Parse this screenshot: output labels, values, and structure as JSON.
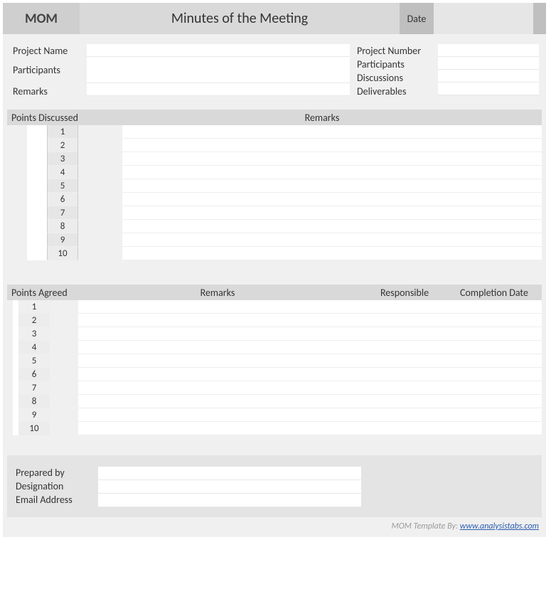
{
  "header": {
    "mom": "MOM",
    "title": "Minutes of the Meeting",
    "date_label": "Date",
    "date_value": ""
  },
  "info": {
    "left": {
      "project_name_label": "Project Name",
      "project_name_value": "",
      "participants_label": "Participants",
      "participants_value": "",
      "remarks_label": "Remarks",
      "remarks_value": ""
    },
    "right": {
      "project_number_label": "Project Number",
      "project_number_value": "",
      "participants_label": "Participants",
      "participants_value": "",
      "discussions_label": "Discussions",
      "discussions_value": "",
      "deliverables_label": "Deliverables",
      "deliverables_value": ""
    }
  },
  "discussed": {
    "head_points": "Points Discussed",
    "head_remarks": "Remarks",
    "rows": [
      {
        "n": "1",
        "remarks": ""
      },
      {
        "n": "2",
        "remarks": ""
      },
      {
        "n": "3",
        "remarks": ""
      },
      {
        "n": "4",
        "remarks": ""
      },
      {
        "n": "5",
        "remarks": ""
      },
      {
        "n": "6",
        "remarks": ""
      },
      {
        "n": "7",
        "remarks": ""
      },
      {
        "n": "8",
        "remarks": ""
      },
      {
        "n": "9",
        "remarks": ""
      },
      {
        "n": "10",
        "remarks": ""
      }
    ]
  },
  "agreed": {
    "head_points": "Points Agreed",
    "head_remarks": "Remarks",
    "head_responsible": "Responsible",
    "head_completion": "Completion Date",
    "rows": [
      {
        "n": "1",
        "remarks": "",
        "responsible": "",
        "completion": ""
      },
      {
        "n": "2",
        "remarks": "",
        "responsible": "",
        "completion": ""
      },
      {
        "n": "3",
        "remarks": "",
        "responsible": "",
        "completion": ""
      },
      {
        "n": "4",
        "remarks": "",
        "responsible": "",
        "completion": ""
      },
      {
        "n": "5",
        "remarks": "",
        "responsible": "",
        "completion": ""
      },
      {
        "n": "6",
        "remarks": "",
        "responsible": "",
        "completion": ""
      },
      {
        "n": "7",
        "remarks": "",
        "responsible": "",
        "completion": ""
      },
      {
        "n": "8",
        "remarks": "",
        "responsible": "",
        "completion": ""
      },
      {
        "n": "9",
        "remarks": "",
        "responsible": "",
        "completion": ""
      },
      {
        "n": "10",
        "remarks": "",
        "responsible": "",
        "completion": ""
      }
    ]
  },
  "footer": {
    "prepared_by_label": "Prepared by",
    "prepared_by_value": "",
    "designation_label": "Designation",
    "designation_value": "",
    "email_label": "Email Address",
    "email_value": ""
  },
  "credit": {
    "prefix": "MOM Template By:  ",
    "link_text": "www.analysistabs.com"
  }
}
